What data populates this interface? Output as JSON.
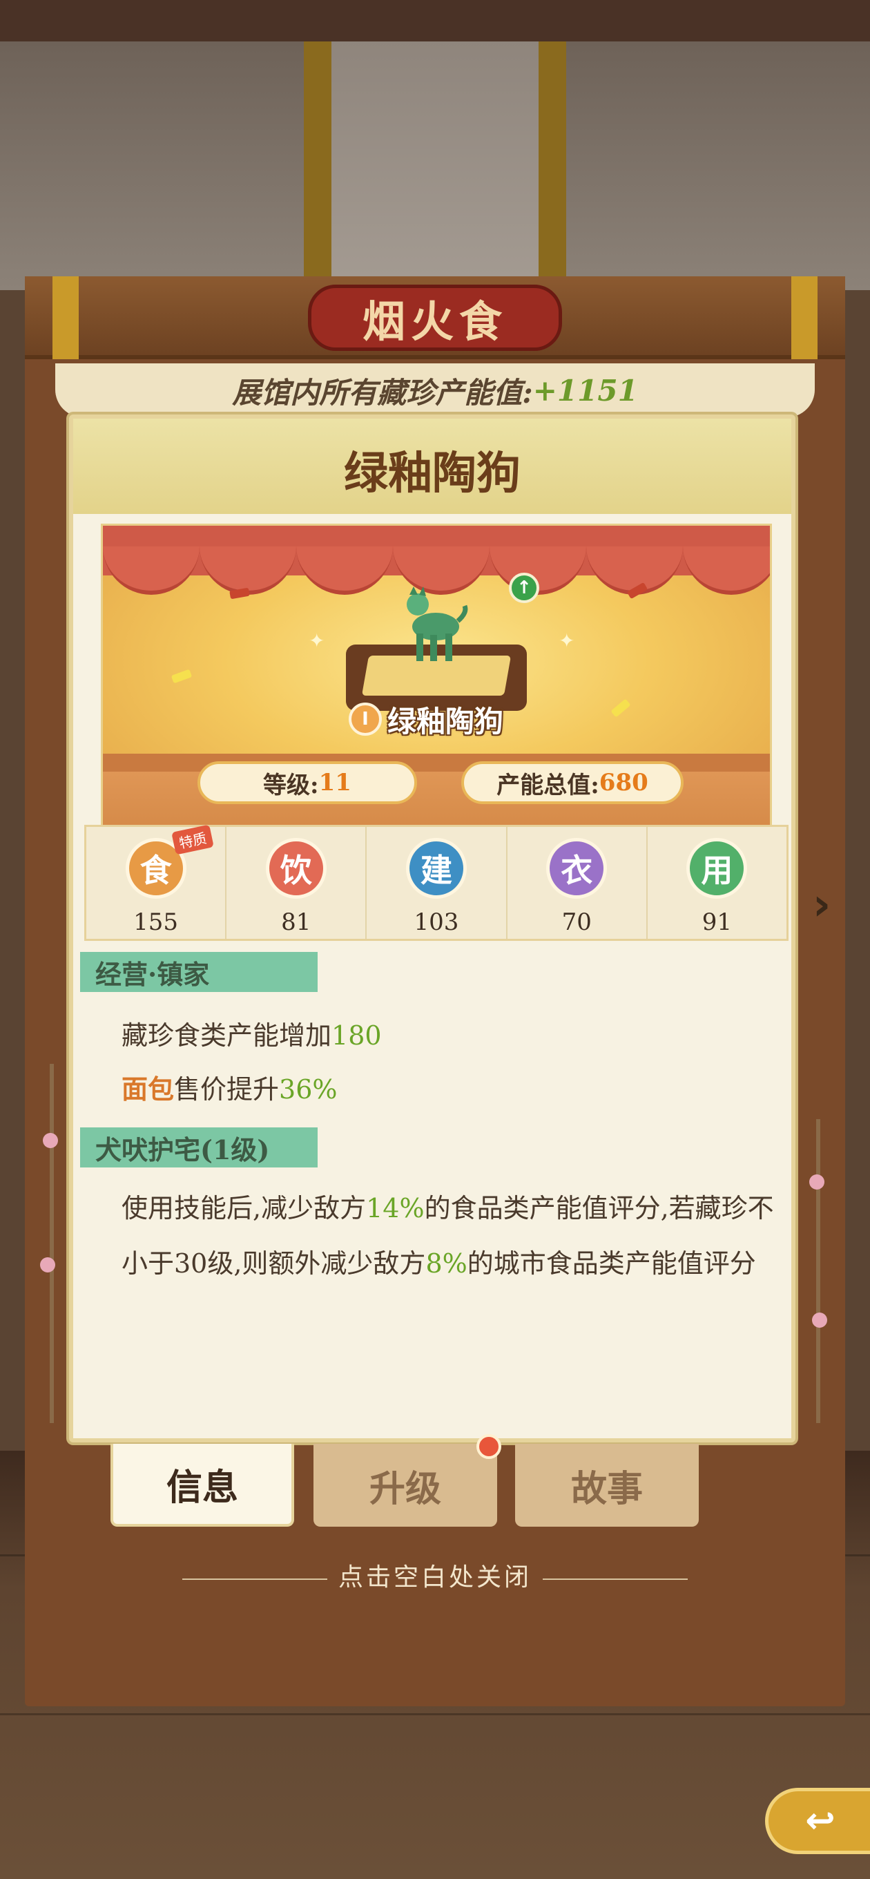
{
  "hall": {
    "title": "烟火食",
    "total_label": "展馆内所有藏珍产能值:",
    "total_value": "+1151"
  },
  "item": {
    "name": "绿釉陶狗",
    "stage_name": "绿釉陶狗",
    "level_badge": "I",
    "level_label": "等级: ",
    "level_value": "11",
    "output_label": "产能总值:",
    "output_value": "680"
  },
  "categories": [
    {
      "icon": "食",
      "value": "155",
      "color": "#e79a45",
      "tag": "特质"
    },
    {
      "icon": "饮",
      "value": "81",
      "color": "#e26a55"
    },
    {
      "icon": "建",
      "value": "103",
      "color": "#3e8fc4"
    },
    {
      "icon": "衣",
      "value": "70",
      "color": "#9a72c8"
    },
    {
      "icon": "用",
      "value": "91",
      "color": "#52b06a"
    }
  ],
  "skill1": {
    "title": "经营·镇家",
    "line1_a": "藏珍食类产能增加",
    "line1_b": "180",
    "line2_a": "面包",
    "line2_b": "售价提升",
    "line2_c": "36%"
  },
  "skill2": {
    "title": "犬吠护宅(1级)",
    "line1_a": "使用技能后,减少敌方",
    "line1_b": "14%",
    "line1_c": "的食品类产能值评分,若藏珍不",
    "line2_a": "小于30级,则额外减少敌方",
    "line2_b": "8%",
    "line2_c": "的城市食品类产能值评分"
  },
  "tabs": {
    "info": "信息",
    "upgrade": "升级",
    "story": "故事"
  },
  "close_hint": "点击空白处关闭",
  "icons": {
    "next": "chevron-right-icon",
    "back": "back-arrow-icon",
    "level_up": "arrow-up-icon"
  }
}
